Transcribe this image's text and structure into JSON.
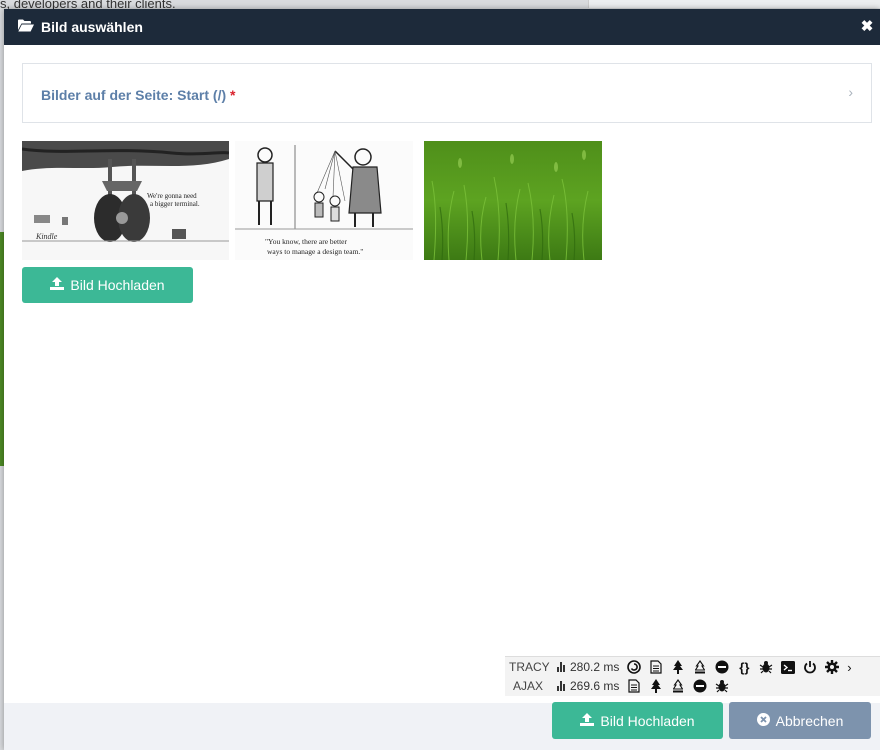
{
  "background": {
    "text": "s, developers and their clients."
  },
  "modal": {
    "title": "Bild auswählen",
    "close_icon": "close-icon"
  },
  "panel": {
    "title": "Bilder auf der Seite: Start (/)",
    "required_mark": "*"
  },
  "images": [
    {
      "name": "cartoon-landing-gear",
      "caption": "We're gonna need a bigger terminal."
    },
    {
      "name": "cartoon-puppet-team",
      "caption": "\"You know, there are better ways to manage a design team.\""
    },
    {
      "name": "grass-photo"
    }
  ],
  "buttons": {
    "upload_inline": "Bild Hochladen",
    "upload_footer": "Bild Hochladen",
    "cancel": "Abbrechen"
  },
  "tracy": {
    "row1_label": "TRACY",
    "row1_time": "280.2 ms",
    "row2_label": "AJAX",
    "row2_time": "269.6 ms"
  },
  "colors": {
    "header": "#1d2a3a",
    "primary_green": "#3cb896",
    "cancel_gray": "#7d93ad",
    "panel_title": "#5d7fa8",
    "required": "#d9232d"
  }
}
